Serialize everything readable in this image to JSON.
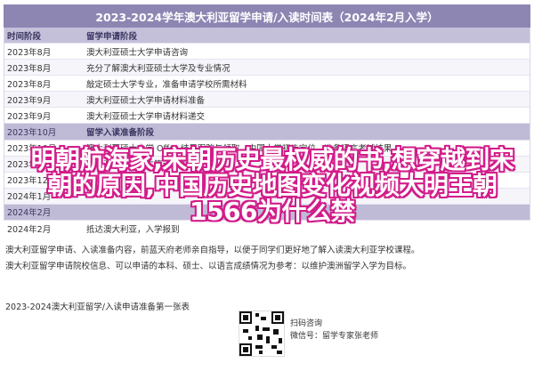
{
  "title": "2023-2024学年澳大利亚留学申请/入读时间表（2024年2月入学）",
  "table": {
    "header": {
      "time": "时间阶段",
      "task": "留学申请阶段"
    },
    "rows": [
      {
        "time": "2023年8月",
        "task": "澳大利亚硕士大学申请咨询",
        "type": "normal"
      },
      {
        "time": "2023年8月",
        "task": "充分了解澳大利亚硕士大学及专业情况",
        "type": "alt"
      },
      {
        "time": "2023年8月",
        "task": "敲定硕士大学专业，准备申请学校所需材料",
        "type": "normal"
      },
      {
        "time": "2023年9月",
        "task": "澳大利亚硕士大学申请材料准备",
        "type": "alt"
      },
      {
        "time": "2023年9月",
        "task": "澳大利亚硕士大学申请材料递交",
        "type": "normal"
      },
      {
        "time": "2023年10月",
        "task": "留学入读准备阶段",
        "type": "section"
      },
      {
        "time": "2023年10月",
        "task": "澳大利亚硕士大学 Offer 结果跟踪与领取，中国大学初步定位，准备语言考试结果",
        "type": "normal"
      },
      {
        "time": "2023年11月",
        "task": "申请澳大利亚学生签证（如适用）",
        "type": "alt"
      },
      {
        "time": "2023年12月",
        "task": "",
        "type": "normal"
      },
      {
        "time": "2024年1月",
        "task": "",
        "type": "alt"
      },
      {
        "time": "2024年2月",
        "task": "",
        "type": "section"
      },
      {
        "time": "2024年2月",
        "task": "抵达澳大利亚，入学报到",
        "type": "normal"
      }
    ]
  },
  "notes": [
    "澳大利亚留学申请、入读准备内容，前蓝天府老师亲自指导，以便于同学们更好地了解入读澳大利亚学校课程。",
    "澳大利亚留学申请院校信息、可以申请的本科、硕士、以语言成绩情况为参考：以维护澳洲留学入学为目标。"
  ],
  "footer": "2023-2024澳大利亚留学/入读申请准备第一张表",
  "qr_caption": [
    "扫码咨询",
    "微信号：留学专家张老师"
  ],
  "overlay_text": "明朝航海家,宋朝历史最权威的书,想穿越到宋朝的原因,中国历史地图变化视频大明王朝1566为什么禁"
}
